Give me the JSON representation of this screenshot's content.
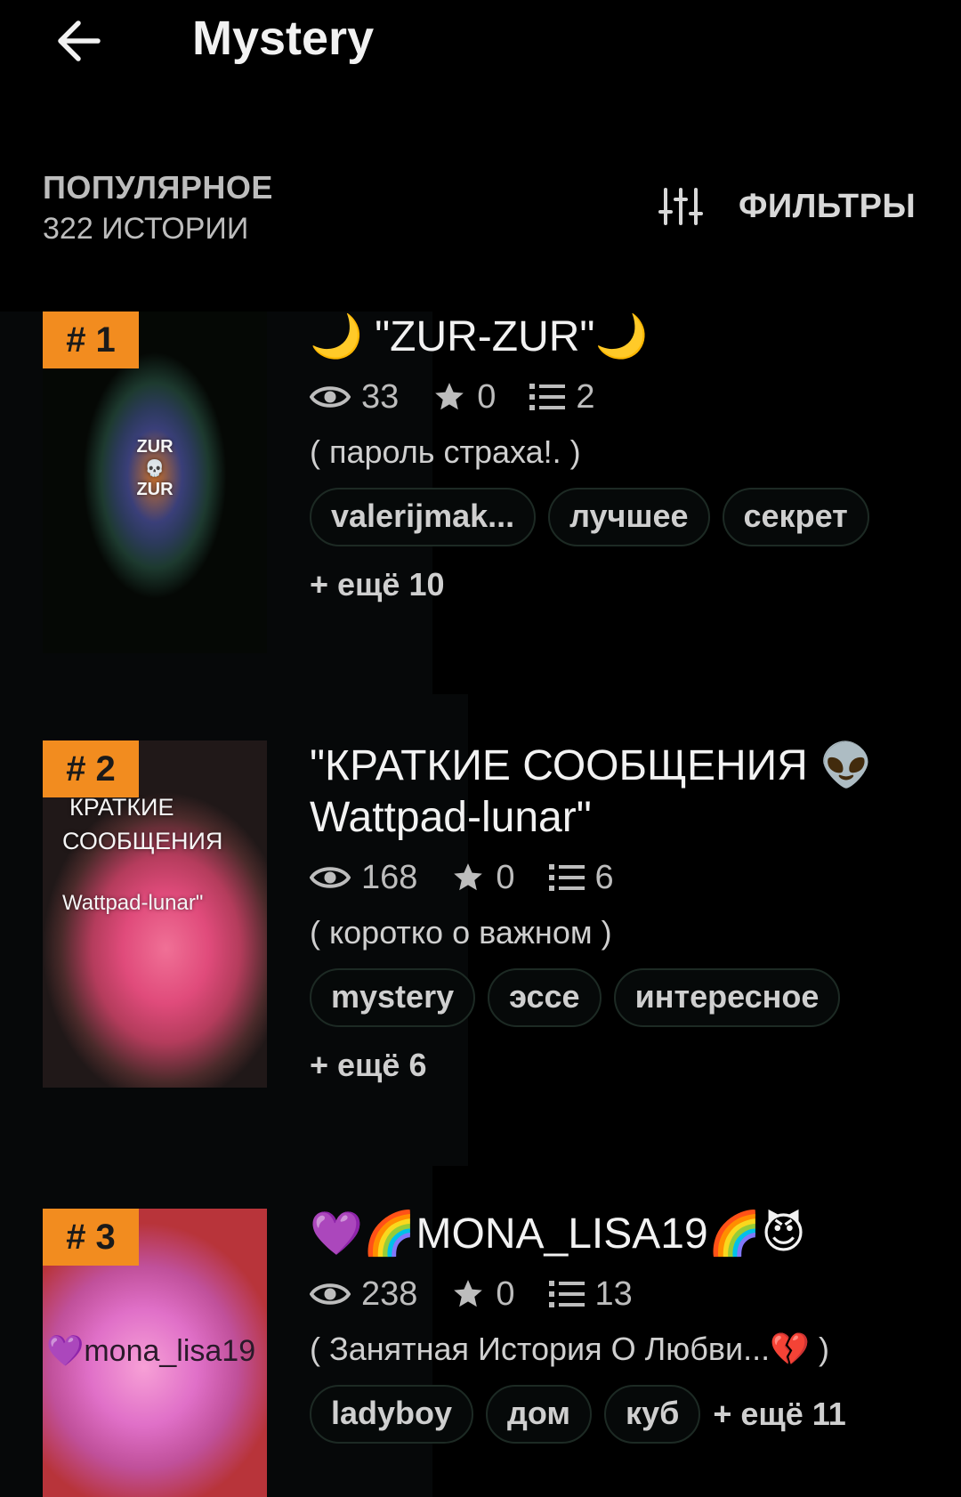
{
  "header": {
    "title": "Mystery"
  },
  "section": {
    "title": "ПОПУЛЯРНОЕ",
    "count": "322 ИСТОРИИ",
    "filters_label": "ФИЛЬТРЫ"
  },
  "stories": [
    {
      "rank": "# 1",
      "title": "🌙 \"ZUR-ZUR\"🌙",
      "views": "33",
      "votes": "0",
      "parts": "2",
      "description": "( пароль страха!. )",
      "tags": [
        "valerijmak...",
        "лучшее",
        "секрет"
      ],
      "more": "+ ещё 10",
      "cover_text_1": "ZUR",
      "cover_text_2": "💀",
      "cover_text_3": "ZUR"
    },
    {
      "rank": "# 2",
      "title": "\"КРАТКИЕ СООБЩЕНИЯ 👽 Wattpad-lunar\"",
      "views": "168",
      "votes": "0",
      "parts": "6",
      "description": "( коротко о важном )",
      "tags": [
        "mystery",
        "эссе",
        "интересное"
      ],
      "more": "+ ещё 6",
      "cover_text_1": "КРАТКИЕ",
      "cover_text_2": "СООБЩЕНИЯ",
      "cover_text_3": "Wattpad-lunar\""
    },
    {
      "rank": "# 3",
      "title": "💜🌈MONA_LISA19🌈😈",
      "views": "238",
      "votes": "0",
      "parts": "13",
      "description": "(  Занятная История О Любви...💔 )",
      "tags": [
        "ladyboy",
        "дом",
        "куб"
      ],
      "more": "+ ещё 11",
      "cover_text_1": "💜mona_lisa19"
    }
  ],
  "colors": {
    "background": "#000000",
    "rank_badge": "#f28c1f",
    "text": "#e6e6e6",
    "muted": "#bdbdbd"
  },
  "icons": [
    "back-arrow-icon",
    "filter-sliders-icon",
    "eye-icon",
    "star-icon",
    "list-icon"
  ]
}
